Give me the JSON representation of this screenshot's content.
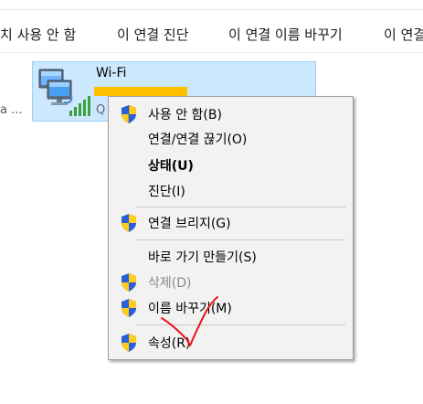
{
  "toolbar": {
    "items": [
      {
        "label": "치 사용 안 함"
      },
      {
        "label": "이 연결 진단"
      },
      {
        "label": "이 연결 이름 바꾸기"
      },
      {
        "label": "이 연결"
      }
    ]
  },
  "left_fragment": "a ...",
  "network": {
    "name": "Wi-Fi",
    "status_partial": "Q"
  },
  "context_menu": {
    "items": [
      {
        "label": "사용 안 함(B)"
      },
      {
        "label": "연결/연결 끊기(O)"
      },
      {
        "label": "상태(U)"
      },
      {
        "label": "진단(I)"
      },
      {
        "label": "연결 브리지(G)"
      },
      {
        "label": "바로 가기 만들기(S)"
      },
      {
        "label": "삭제(D)"
      },
      {
        "label": "이름 바꾸기(M)"
      },
      {
        "label": "속성(R)"
      }
    ]
  },
  "colors": {
    "selection_bg": "#cce8ff",
    "selection_border": "#99d1ff",
    "menu_bg": "#f2f2f2",
    "redaction": "#ffc000",
    "annotation": "#e8141b",
    "signal_green": "#3aa13a"
  }
}
